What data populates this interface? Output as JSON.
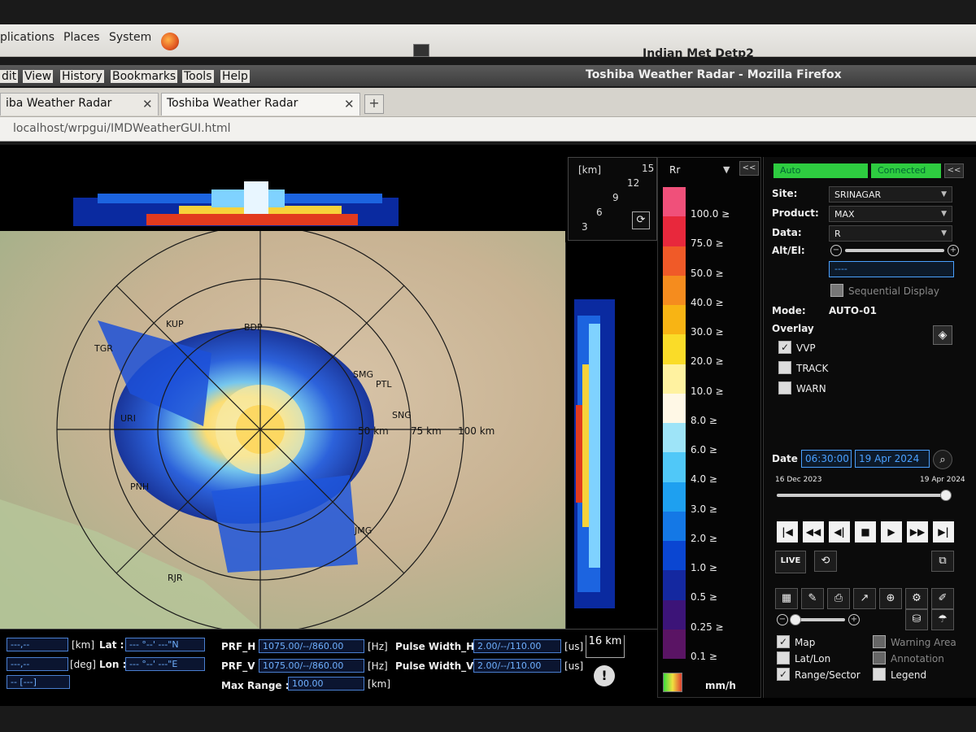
{
  "os": {
    "menus": [
      "plications",
      "Places",
      "System"
    ],
    "host": "Indian Met Detp2"
  },
  "window": {
    "title": "Toshiba Weather Radar - Mozilla Firefox",
    "menus": [
      "dit",
      "View",
      "History",
      "Bookmarks",
      "Tools",
      "Help"
    ]
  },
  "tabs": [
    {
      "label": "iba Weather Radar"
    },
    {
      "label": "Toshiba Weather Radar"
    }
  ],
  "url": "localhost/wrpgui/IMDWeatherGUI.html",
  "height_scale": {
    "unit": "[km]",
    "ticks": [
      "15",
      "12",
      "9",
      "6",
      "3"
    ]
  },
  "map": {
    "range_labels": [
      "50 km",
      "75 km",
      "100 km"
    ],
    "stations": [
      "KUP",
      "TGR",
      "BDP",
      "URI",
      "SMG",
      "PTL",
      "PNH",
      "JMG",
      "RJR",
      "SNG"
    ]
  },
  "legend": {
    "product": "Rr",
    "collapse": "<<",
    "unit": "mm/h",
    "bands": [
      {
        "label": "100.0 ≥",
        "color": "#f0507a"
      },
      {
        "label": "75.0 ≥",
        "color": "#e8283c"
      },
      {
        "label": "50.0 ≥",
        "color": "#f05a28"
      },
      {
        "label": "40.0 ≥",
        "color": "#f58c1e"
      },
      {
        "label": "30.0 ≥",
        "color": "#f8b414"
      },
      {
        "label": "20.0 ≥",
        "color": "#fadc28"
      },
      {
        "label": "10.0 ≥",
        "color": "#fff2a0"
      },
      {
        "label": "8.0 ≥",
        "color": "#fff8e6"
      },
      {
        "label": "6.0 ≥",
        "color": "#9ee4f8"
      },
      {
        "label": "4.0 ≥",
        "color": "#50c8f8"
      },
      {
        "label": "3.0 ≥",
        "color": "#1ea0f0"
      },
      {
        "label": "2.0 ≥",
        "color": "#1478e6"
      },
      {
        "label": "1.0 ≥",
        "color": "#0a46d2"
      },
      {
        "label": "0.5 ≥",
        "color": "#1428a0"
      },
      {
        "label": "0.25 ≥",
        "color": "#3c1478"
      },
      {
        "label": "0.1 ≥",
        "color": "#5a1464"
      }
    ]
  },
  "control": {
    "mode_status": "Auto",
    "conn_status": "Connected",
    "collapse": "<<",
    "site_label": "Site:",
    "site_value": "SRINAGAR",
    "product_label": "Product:",
    "product_value": "MAX",
    "data_label": "Data:",
    "data_value": "R",
    "alt_label": "Alt/El:",
    "alt_value": "----",
    "sequential": "Sequential Display",
    "mode_label": "Mode:",
    "mode_value": "AUTO-01",
    "overlay_label": "Overlay",
    "overlays": [
      {
        "label": "VVP",
        "checked": true
      },
      {
        "label": "TRACK",
        "checked": false
      },
      {
        "label": "WARN",
        "checked": false
      }
    ],
    "date_label": "Date",
    "time_value": "06:30:00",
    "date_value": "19 Apr 2024",
    "range_start": "16 Dec 2023",
    "range_end": "19 Apr 2024",
    "timeline_position": 0.98,
    "live_label": "LIVE",
    "layers": [
      {
        "label": "Map",
        "checked": true,
        "enabled": true
      },
      {
        "label": "Warning Area",
        "checked": false,
        "enabled": false
      },
      {
        "label": "Lat/Lon",
        "checked": false,
        "enabled": true
      },
      {
        "label": "Annotation",
        "checked": false,
        "enabled": false
      },
      {
        "label": "Range/Sector",
        "checked": true,
        "enabled": true
      },
      {
        "label": "Legend",
        "checked": false,
        "enabled": true
      }
    ]
  },
  "info": {
    "range_val": "---,--",
    "range_unit": "[km]",
    "lat_label": "Lat :",
    "lat_val": "--- °--' ---\"N",
    "az_val": "---,--",
    "az_unit": "[deg]",
    "lon_label": "Lon :",
    "lon_val": "--- °--' ---\"E",
    "val3": "-- [---]",
    "prf_h_label": "PRF_H :",
    "prf_h_val": "1075.00/--/860.00",
    "prf_h_unit": "[Hz]",
    "prf_v_label": "PRF_V :",
    "prf_v_val": "1075.00/--/860.00",
    "prf_v_unit": "[Hz]",
    "maxrange_label": "Max Range :",
    "maxrange_val": "100.00",
    "maxrange_unit": "[km]",
    "pw_h_label": "Pulse Width_H :",
    "pw_h_val": "2.00/--/110.00",
    "pw_h_unit": "[us]",
    "pw_v_label": "Pulse Width_V :",
    "pw_v_val": "2.00/--/110.00",
    "pw_v_unit": "[us]",
    "scale": "16 km"
  }
}
